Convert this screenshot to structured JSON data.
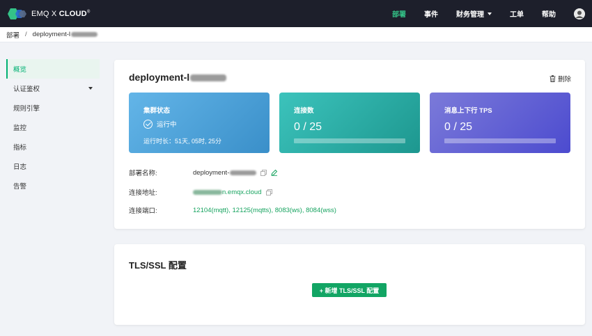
{
  "brand": {
    "name_prefix": "EMQ X ",
    "name_bold": "CLOUD",
    "mark": "®"
  },
  "nav": {
    "items": [
      {
        "label": "部署",
        "active": true
      },
      {
        "label": "事件"
      },
      {
        "label": "财务管理",
        "dropdown": true
      },
      {
        "label": "工单"
      },
      {
        "label": "帮助"
      }
    ]
  },
  "breadcrumb": {
    "root": "部署",
    "separator": "/",
    "current": "deployment-l"
  },
  "sidebar": {
    "items": [
      {
        "label": "概览",
        "active": true
      },
      {
        "label": "认证鉴权",
        "dropdown": true
      },
      {
        "label": "规则引擎"
      },
      {
        "label": "监控"
      },
      {
        "label": "指标"
      },
      {
        "label": "日志"
      },
      {
        "label": "告警"
      }
    ]
  },
  "deployment": {
    "title": "deployment-l",
    "delete_label": "删除",
    "stats": [
      {
        "label": "集群状态",
        "status": "运行中",
        "uptime": "运行时长：51天, 05时, 25分"
      },
      {
        "label": "连接数",
        "value": "0 / 25",
        "progress": 0
      },
      {
        "label": "消息上下行 TPS",
        "value": "0 / 25",
        "progress": 0
      }
    ],
    "info": {
      "name_label": "部署名称:",
      "name_value": "deployment-",
      "address_label": "连接地址:",
      "address_value": "n.emqx.cloud",
      "ports_label": "连接端口:",
      "ports_value": "12104(mqtt), 12125(mqtts), 8083(ws), 8084(wss)"
    }
  },
  "tls": {
    "title": "TLS/SSL 配置",
    "add_label": "+ 新增 TLS/SSL 配置"
  },
  "colors": {
    "accent": "#00b173",
    "nav_bg": "#1d1f2b",
    "button": "#12a564"
  }
}
